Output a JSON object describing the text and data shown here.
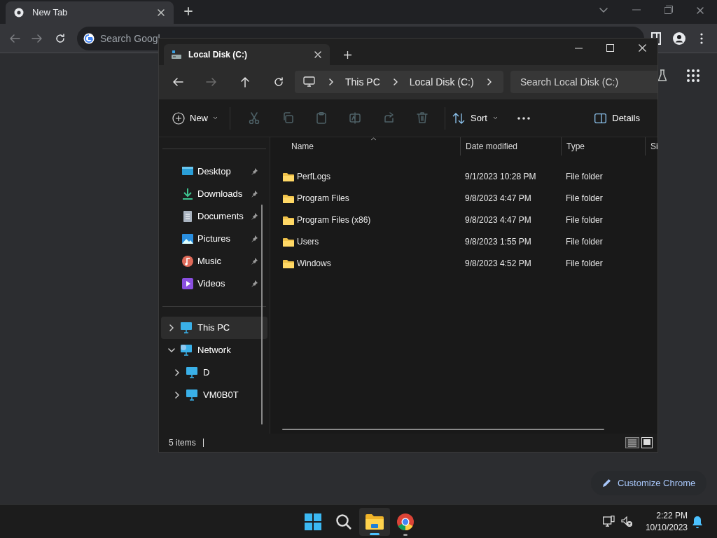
{
  "chrome": {
    "tab_title": "New Tab",
    "omnibox_placeholder": "Search Googl",
    "customize_button": "Customize Chrome"
  },
  "explorer": {
    "tab_title": "Local Disk (C:)",
    "breadcrumb": [
      "This PC",
      "Local Disk (C:)"
    ],
    "search_placeholder": "Search Local Disk (C:)",
    "toolbar": {
      "new_label": "New",
      "actions": [
        {
          "disabled": true
        },
        {
          "disabled": true
        },
        {
          "disabled": true
        },
        {
          "disabled": true
        },
        {
          "disabled": true
        },
        {
          "disabled": true
        }
      ],
      "sort_label": "Sort",
      "details_label": "Details"
    },
    "quick_access": [
      {
        "label": "Desktop",
        "pinned": true
      },
      {
        "label": "Downloads",
        "pinned": true
      },
      {
        "label": "Documents",
        "pinned": true
      },
      {
        "label": "Pictures",
        "pinned": true
      },
      {
        "label": "Music",
        "pinned": true
      },
      {
        "label": "Videos",
        "pinned": true
      }
    ],
    "nav_tree": [
      {
        "label": "This PC",
        "expanded": false,
        "selected": true
      },
      {
        "label": "Network",
        "expanded": true,
        "selected": false,
        "children": [
          {
            "label": "D",
            "expanded": false,
            "selected": false
          },
          {
            "label": "VM0B0T",
            "expanded": false,
            "selected": false
          }
        ]
      }
    ],
    "columns": [
      "Name",
      "Date modified",
      "Type",
      "Si"
    ],
    "rows": [
      {
        "name": "PerfLogs",
        "date": "9/1/2023 10:28 PM",
        "type": "File folder"
      },
      {
        "name": "Program Files",
        "date": "9/8/2023 4:47 PM",
        "type": "File folder"
      },
      {
        "name": "Program Files (x86)",
        "date": "9/8/2023 4:47 PM",
        "type": "File folder"
      },
      {
        "name": "Users",
        "date": "9/8/2023 1:55 PM",
        "type": "File folder"
      },
      {
        "name": "Windows",
        "date": "9/8/2023 4:52 PM",
        "type": "File folder"
      }
    ],
    "status": "5 items"
  },
  "taskbar": {
    "apps": [
      {
        "active": false
      },
      {
        "active": false
      },
      {
        "active": true
      },
      {
        "active": false
      }
    ],
    "time": "2:22 PM",
    "date": "10/10/2023"
  }
}
